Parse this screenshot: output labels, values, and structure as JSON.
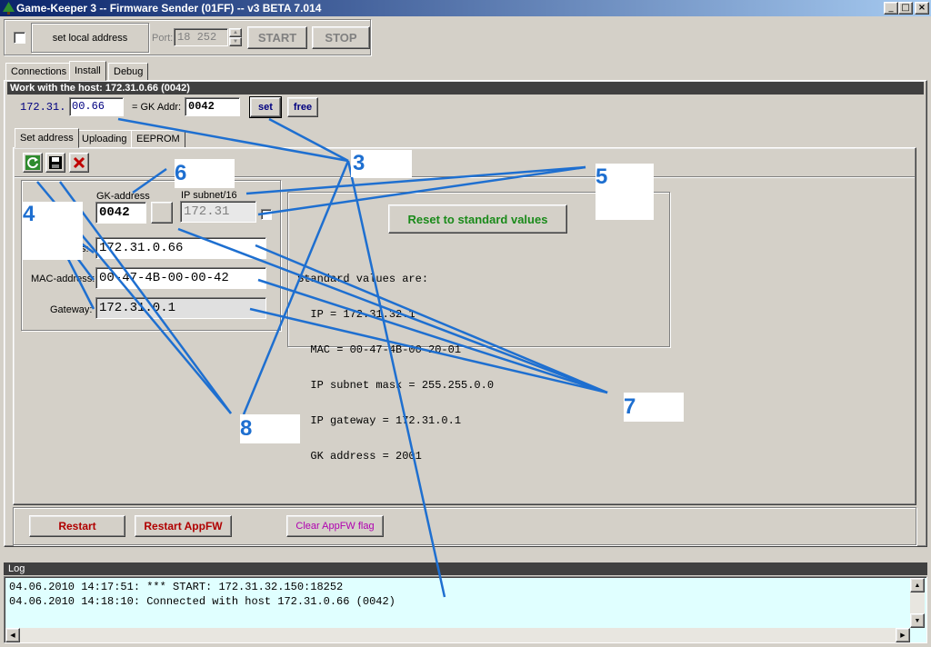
{
  "window": {
    "title": "Game-Keeper 3 -- Firmware Sender (01FF) -- v3 BETA 7.014",
    "minimize": "_",
    "maximize": "□",
    "close": "×"
  },
  "topbar": {
    "set_local_label": "set local address",
    "port_label": "Port:",
    "port_value": "18 252",
    "start_label": "START",
    "stop_label": "STOP"
  },
  "main_tabs": [
    "Connections",
    "Install",
    "Debug"
  ],
  "host_bar": {
    "title": "Work with the host:  172.31.0.66 (0042)",
    "ip_prefix": "172.31.",
    "ip_suffix": "00.66",
    "gk_addr_label": "= GK Addr:",
    "gk_addr_value": "0042",
    "set_label": "set",
    "free_label": "free"
  },
  "sub_tabs": [
    "Set address",
    "Uploading",
    "EEPROM"
  ],
  "address_panel": {
    "gk_address_label": "GK-address",
    "gk_address_value": "0042",
    "ip_subnet_label": "IP subnet/16",
    "ip_subnet_value": "172.31",
    "ip_label_visible": "s:",
    "ip_value": "172.31.0.66",
    "mac_label": "MAC-address:",
    "mac_value": "00-47-4B-00-00-42",
    "gateway_label": "Gateway:",
    "gateway_value": "172.31.0.1"
  },
  "standard_panel": {
    "reset_label": "Reset to standard values",
    "lines": [
      "Standard values are:",
      "  IP = 172.31.32.1",
      "  MAC = 00-47-4B-00-20-01",
      "  IP subnet mask = 255.255.0.0",
      "  IP gateway = 172.31.0.1",
      "  GK address = 2001"
    ]
  },
  "bottom_buttons": {
    "restart": "Restart",
    "restart_appfw": "Restart AppFW",
    "clear_appfw": "Clear AppFW flag"
  },
  "log": {
    "title": "Log",
    "lines": [
      "04.06.2010 14:17:51: *** START: 172.31.32.150:18252",
      "04.06.2010 14:18:10: Connected with host 172.31.0.66 (0042)"
    ]
  },
  "callouts": [
    "3",
    "4",
    "5",
    "6",
    "7",
    "8"
  ],
  "colors": {
    "callout": "#1e6fd0",
    "reset_text": "#1a8a1a",
    "restart_text": "#b00000",
    "clear_text": "#b000b0",
    "log_bg": "#e0ffff",
    "titlebar_start": "#0a246a"
  }
}
